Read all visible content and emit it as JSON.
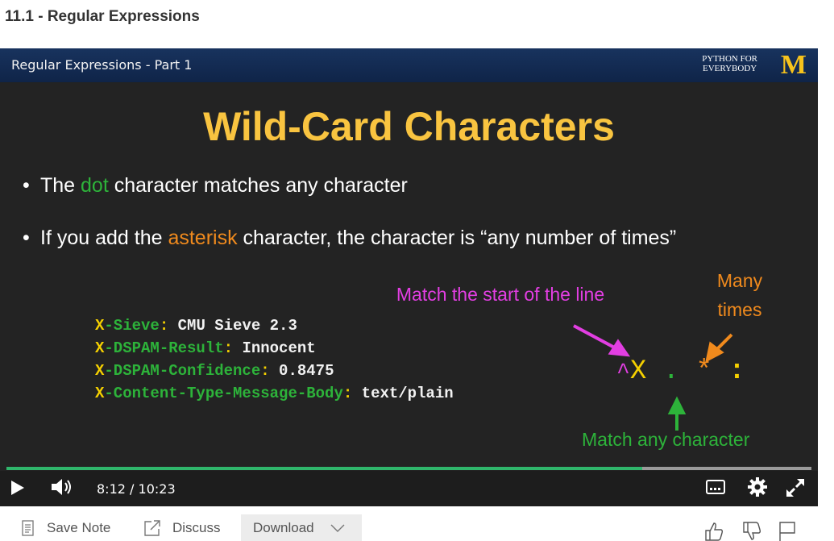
{
  "page": {
    "title": "11.1 - Regular Expressions"
  },
  "slide": {
    "header_title": "Regular Expressions - Part 1",
    "logo_text_line1": "PYTHON FOR",
    "logo_text_line2": "EVERYBODY",
    "logo_letter": "M",
    "title": "Wild-Card Characters",
    "bullet1": {
      "pre": "The ",
      "highlight": "dot",
      "post": " character matches any character"
    },
    "bullet2": {
      "pre": "If you add the ",
      "highlight": "asterisk",
      "post": " character, the character is “any number of times”"
    },
    "code_lines": [
      {
        "x": "X",
        "key": "-Sieve",
        "colon": ":",
        "value": " CMU Sieve 2.3"
      },
      {
        "x": "X",
        "key": "-DSPAM-Result",
        "colon": ":",
        "value": " Innocent"
      },
      {
        "x": "X",
        "key": "-DSPAM-Confidence",
        "colon": ":",
        "value": " 0.8475"
      },
      {
        "x": "X",
        "key": "-Content-Type-Message-Body",
        "colon": ":",
        "value": " text/plain"
      }
    ],
    "annotation_start": "Match the start of the line",
    "annotation_many": "Many times",
    "annotation_any": "Match any character",
    "regex": {
      "caret": "^",
      "x": "X",
      "dot": ".",
      "star": "*",
      "colon": ":"
    },
    "colors": {
      "title": "#f9c440",
      "green": "#2db33a",
      "orange": "#f08a1d",
      "magenta": "#e23ee2",
      "header_bg": "#18335e"
    }
  },
  "player": {
    "current_time": "8:12",
    "separator": "/",
    "duration": "10:23",
    "progress_fraction": 0.79
  },
  "toolbar": {
    "save_note": "Save Note",
    "discuss": "Discuss",
    "download": "Download"
  }
}
